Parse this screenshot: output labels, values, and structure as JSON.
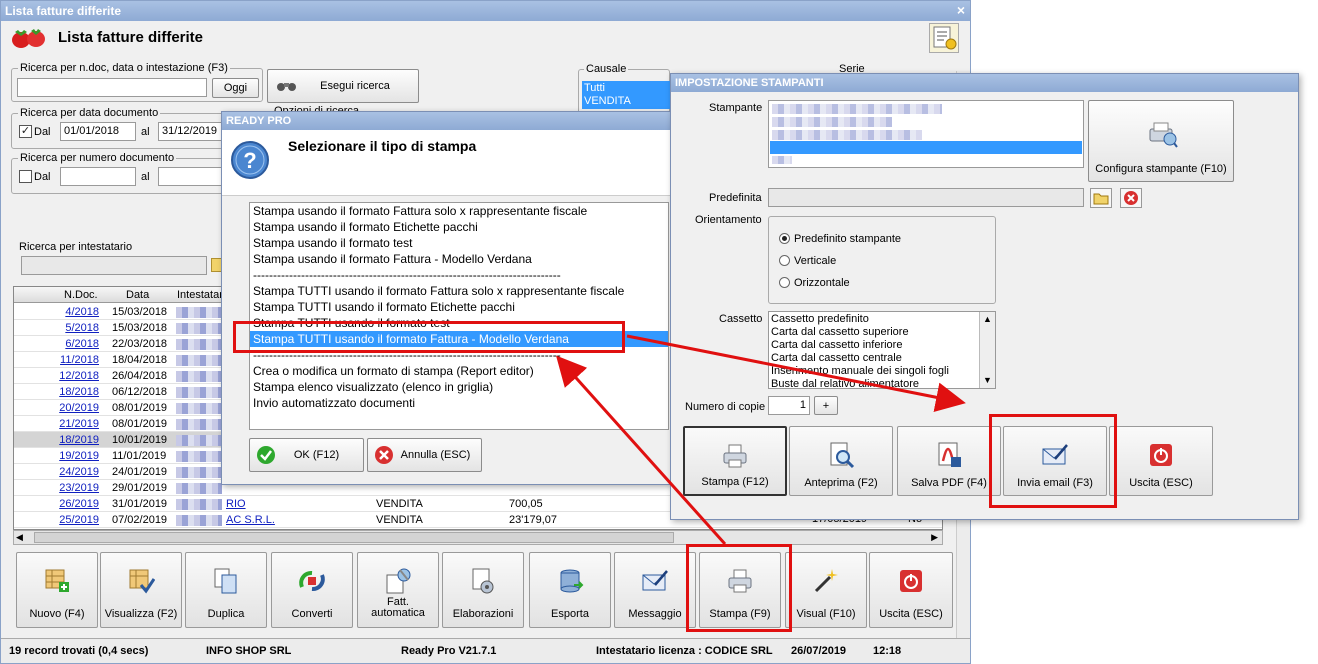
{
  "window": {
    "title": "Lista fatture differite",
    "header": "Lista fatture differite",
    "close": "×"
  },
  "search": {
    "ndoc_label": "Ricerca per n.doc, data o intestazione (F3)",
    "oggi": "Oggi",
    "execute": "Esegui ricerca",
    "option_partial": "Opzioni di ricerca",
    "date_label": "Ricerca per data documento",
    "dal": "Dal",
    "al": "al",
    "date_from": "01/01/2018",
    "date_to": "31/12/2019",
    "number_label": "Ricerca per numero documento",
    "dal2": "Dal",
    "al2": "al",
    "owner_label": "Ricerca per intestatario"
  },
  "causale": {
    "label": "Causale",
    "items": [
      "Tutti",
      "VENDITA"
    ]
  },
  "serie": {
    "label": "Serie"
  },
  "table": {
    "headers": [
      "N.Doc.",
      "Data",
      "Intestatario"
    ],
    "rows": [
      {
        "ndoc": "4/2018",
        "data": "15/03/2018"
      },
      {
        "ndoc": "5/2018",
        "data": "15/03/2018"
      },
      {
        "ndoc": "6/2018",
        "data": "22/03/2018"
      },
      {
        "ndoc": "11/2018",
        "data": "18/04/2018"
      },
      {
        "ndoc": "12/2018",
        "data": "26/04/2018"
      },
      {
        "ndoc": "18/2018",
        "data": "06/12/2018"
      },
      {
        "ndoc": "20/2019",
        "data": "08/01/2019"
      },
      {
        "ndoc": "21/2019",
        "data": "08/01/2019"
      },
      {
        "ndoc": "18/2019",
        "data": "10/01/2019"
      },
      {
        "ndoc": "19/2019",
        "data": "11/01/2019"
      },
      {
        "ndoc": "24/2019",
        "data": "24/01/2019"
      },
      {
        "ndoc": "23/2019",
        "data": "29/01/2019"
      },
      {
        "ndoc": "26/2019",
        "data": "31/01/2019",
        "intest": "RIO",
        "causale": "VENDITA",
        "importo": "700,05"
      },
      {
        "ndoc": "25/2019",
        "data": "07/02/2019",
        "intest": "AC S.R.L.",
        "causale": "VENDITA",
        "importo": "23'179,07"
      }
    ],
    "partial_date": "17/05/2019",
    "partial_code": "No"
  },
  "toolbar": [
    {
      "label": "Nuovo (F4)",
      "icon": "new-icon"
    },
    {
      "label": "Visualizza (F2)",
      "icon": "view-icon"
    },
    {
      "label": "Duplica",
      "icon": "duplicate-icon"
    },
    {
      "label": "Converti",
      "icon": "convert-icon"
    },
    {
      "label": "Fatt.",
      "label2": "automatica",
      "icon": "auto-invoice-icon"
    },
    {
      "label": "Elaborazioni",
      "icon": "process-icon"
    },
    {
      "label": "Esporta",
      "icon": "export-icon"
    },
    {
      "label": "Messaggio",
      "icon": "message-icon"
    },
    {
      "label": "Stampa (F9)",
      "icon": "printer-icon"
    },
    {
      "label": "Visual (F10)",
      "icon": "magic-wand-icon"
    },
    {
      "label": "Uscita (ESC)",
      "icon": "exit-icon"
    }
  ],
  "status": {
    "records": "19 record trovati (0,4 secs)",
    "shop": "INFO SHOP SRL",
    "version": "Ready Pro V21.7.1",
    "license": "Intestatario licenza : CODICE SRL",
    "date": "26/07/2019",
    "time": "12:18"
  },
  "dialog": {
    "title": "READY PRO",
    "question": "Selezionare il tipo di stampa",
    "items": [
      "Stampa usando il formato Fattura solo x rappresentante fiscale",
      "Stampa usando il formato Etichette pacchi",
      "Stampa usando il formato test",
      "Stampa usando il formato Fattura - Modello Verdana",
      "-----------------------------------------------------------------------------",
      "Stampa TUTTI usando il formato Fattura solo x rappresentante fiscale",
      "Stampa TUTTI usando il formato Etichette pacchi",
      "Stampa TUTTI usando il formato test",
      "Stampa TUTTI usando il formato Fattura - Modello Verdana",
      "-----------------------------------------------------------------------------",
      "Crea o modifica un formato di stampa (Report editor)",
      "Stampa elenco visualizzato (elenco in griglia)",
      "Invio automatizzato documenti"
    ],
    "selected_index": 8,
    "ok": "OK (F12)",
    "cancel": "Annulla (ESC)"
  },
  "printer": {
    "title": "IMPOSTAZIONE STAMPANTI",
    "stampante_label": "Stampante",
    "config": "Configura stampante (F10)",
    "predefinita_label": "Predefinita",
    "orient_label": "Orientamento",
    "orient": [
      "Predefinito stampante",
      "Verticale",
      "Orizzontale"
    ],
    "cassetto_label": "Cassetto",
    "cassetto": [
      "Cassetto predefinito",
      "Carta dal cassetto superiore",
      "Carta dal cassetto inferiore",
      "Carta dal cassetto centrale",
      "Inserimento manuale dei singoli fogli",
      "Buste dal relativo alimentatore"
    ],
    "copie_label": "Numero di copie",
    "copie": "1",
    "plus": "+",
    "buttons": [
      "Stampa (F12)",
      "Anteprima (F2)",
      "Salva PDF (F4)",
      "Invia email (F3)",
      "Uscita (ESC)"
    ]
  },
  "colors": {
    "titlebar": "#9bb6dc",
    "selection": "#3399ff",
    "annotation": "#e01010"
  }
}
